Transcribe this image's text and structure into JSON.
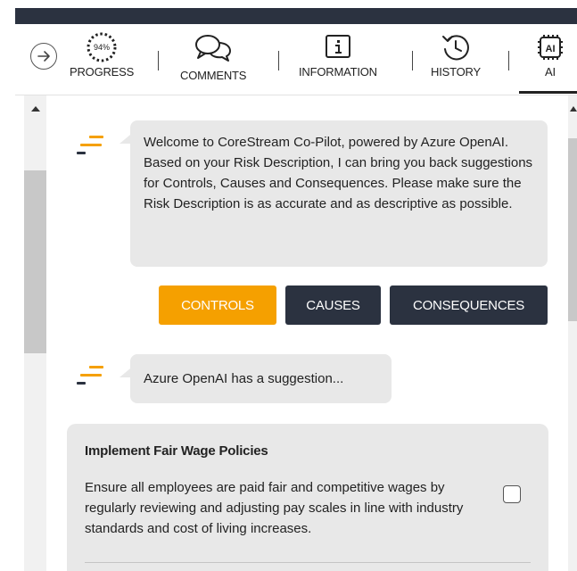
{
  "tabs": [
    {
      "label": "PROGRESS",
      "icon": "progress-ring-icon",
      "value_text": "94%"
    },
    {
      "label": "COMMENTS",
      "icon": "comments-icon"
    },
    {
      "label": "INFORMATION",
      "icon": "information-icon"
    },
    {
      "label": "HISTORY",
      "icon": "history-icon"
    },
    {
      "label": "AI",
      "icon": "ai-chip-icon",
      "active": true
    }
  ],
  "chat": {
    "welcome_message": "Welcome to CoreStream Co-Pilot, powered by Azure OpenAI. Based on your Risk Description, I can bring you back suggestions for Controls, Causes and Consequences. Please make sure the Risk Description is as accurate and as descriptive as possible.",
    "suggestion_message": "Azure OpenAI has a suggestion..."
  },
  "buttons": {
    "controls": "CONTROLS",
    "causes": "CAUSES",
    "consequences": "CONSEQUENCES"
  },
  "suggestion": {
    "title": "Implement Fair Wage Policies",
    "description": "Ensure all employees are paid fair and competitive wages by regularly reviewing and adjusting pay scales in line with industry standards and cost of living increases.",
    "checked": false
  },
  "colors": {
    "accent_orange": "#f5a000",
    "dark_button": "#2b3240",
    "bubble_bg": "#e8e8e8"
  }
}
